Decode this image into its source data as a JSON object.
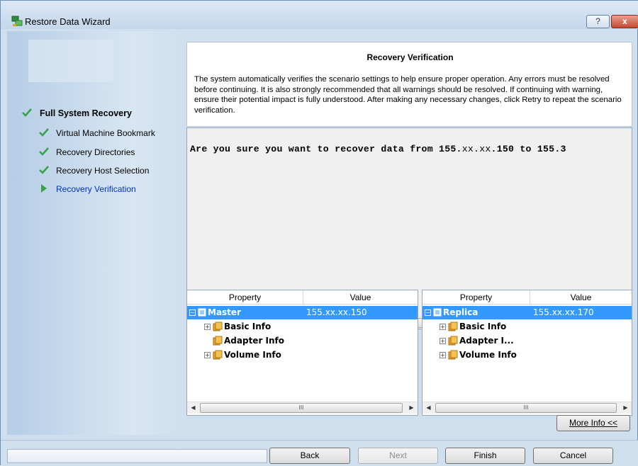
{
  "window": {
    "title": "Restore Data Wizard",
    "help_label": "?",
    "close_label": "x"
  },
  "sidebar": {
    "steps": [
      {
        "label": "Full System Recovery",
        "state": "done",
        "level": 0
      },
      {
        "label": "Virtual Machine Bookmark",
        "state": "done",
        "level": 1
      },
      {
        "label": "Recovery Directories",
        "state": "done",
        "level": 1
      },
      {
        "label": "Recovery Host Selection",
        "state": "done",
        "level": 1
      },
      {
        "label": "Recovery Verification",
        "state": "current",
        "level": 1
      }
    ]
  },
  "header": {
    "title": "Recovery Verification",
    "description": "The system automatically verifies the scenario settings to help ensure proper operation. Any errors must be resolved before continuing. It is also strongly recommended that all warnings should be resolved. If continuing with warning, ensure their potential impact is fully understood. After making any necessary changes, click Retry to repeat the scenario verification."
  },
  "message": {
    "text_prefix": "Are you sure you want to recover data from 155.",
    "masked_1": "xx.xx",
    "text_middle": ".150 to 155.3"
  },
  "scrollbar": {
    "grip": "III"
  },
  "master_grid": {
    "columns": [
      "Property",
      "Value"
    ],
    "rows": [
      {
        "name": "Master",
        "value": "155.xx.xx.150",
        "selected": true,
        "expander": "−"
      },
      {
        "name": "Basic Info",
        "value": "",
        "expander": "+"
      },
      {
        "name": "Adapter Info",
        "value": "",
        "expander": ""
      },
      {
        "name": "Volume Info",
        "value": "",
        "expander": "+"
      }
    ]
  },
  "replica_grid": {
    "columns": [
      "Property",
      "Value"
    ],
    "rows": [
      {
        "name": "Replica",
        "value": "155.xx.xx.170",
        "selected": true,
        "expander": "−"
      },
      {
        "name": "Basic Info",
        "value": "",
        "expander": "+"
      },
      {
        "name": "Adapter I...",
        "value": "",
        "expander": "+"
      },
      {
        "name": "Volume Info",
        "value": "",
        "expander": "+"
      }
    ]
  },
  "buttons": {
    "more_info": "More Info <<",
    "back": "Back",
    "next": "Next",
    "finish": "Finish",
    "cancel": "Cancel"
  },
  "colors": {
    "selection": "#3399ff",
    "current_step": "#0033cc",
    "check": "#3aa14a"
  }
}
